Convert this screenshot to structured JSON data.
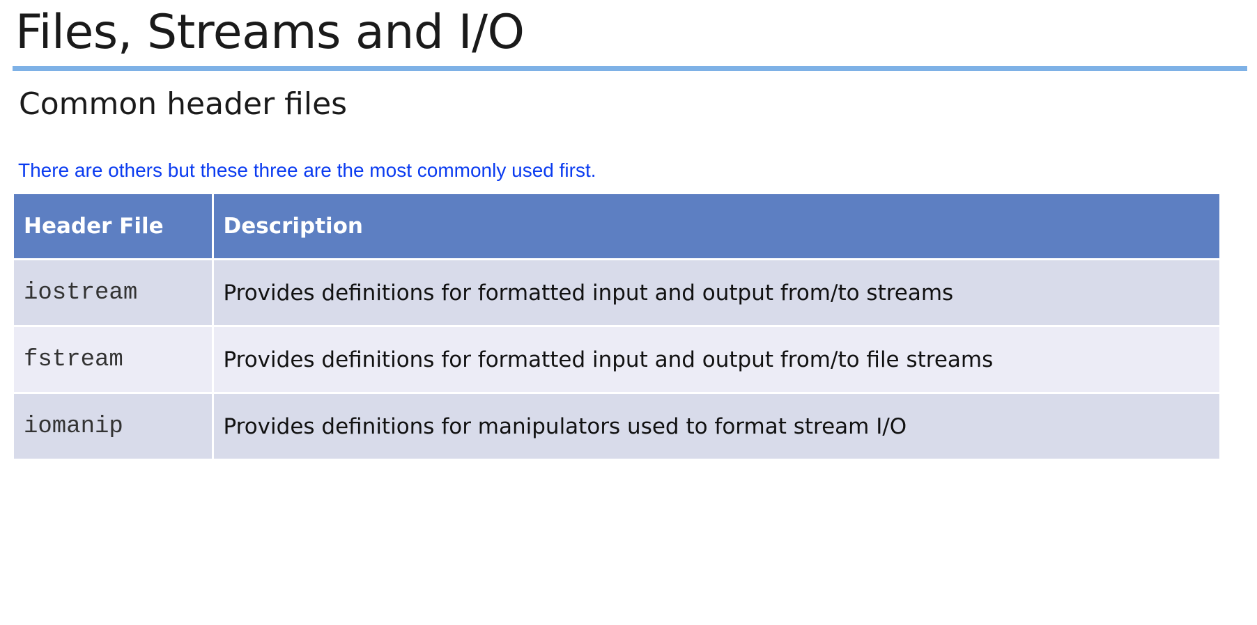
{
  "slide": {
    "title": "Files, Streams and I/O",
    "subtitle": "Common header files",
    "note": "There are others but these three are the most commonly used first."
  },
  "table": {
    "columns": [
      "Header File",
      "Description"
    ],
    "rows": [
      {
        "file": "iostream",
        "description": "Provides definitions for formatted input and output from/to streams"
      },
      {
        "file": "fstream",
        "description": "Provides definitions for formatted input and output from/to file streams"
      },
      {
        "file": "iomanip",
        "description": "Provides definitions for manipulators used to format stream I/O"
      }
    ]
  },
  "colors": {
    "title_rule": "#7eb1e6",
    "note_text": "#0a3bf0",
    "table_header": "#5d7fc2",
    "row_band_dark": "#d8dbea",
    "row_band_light": "#ececf6"
  }
}
